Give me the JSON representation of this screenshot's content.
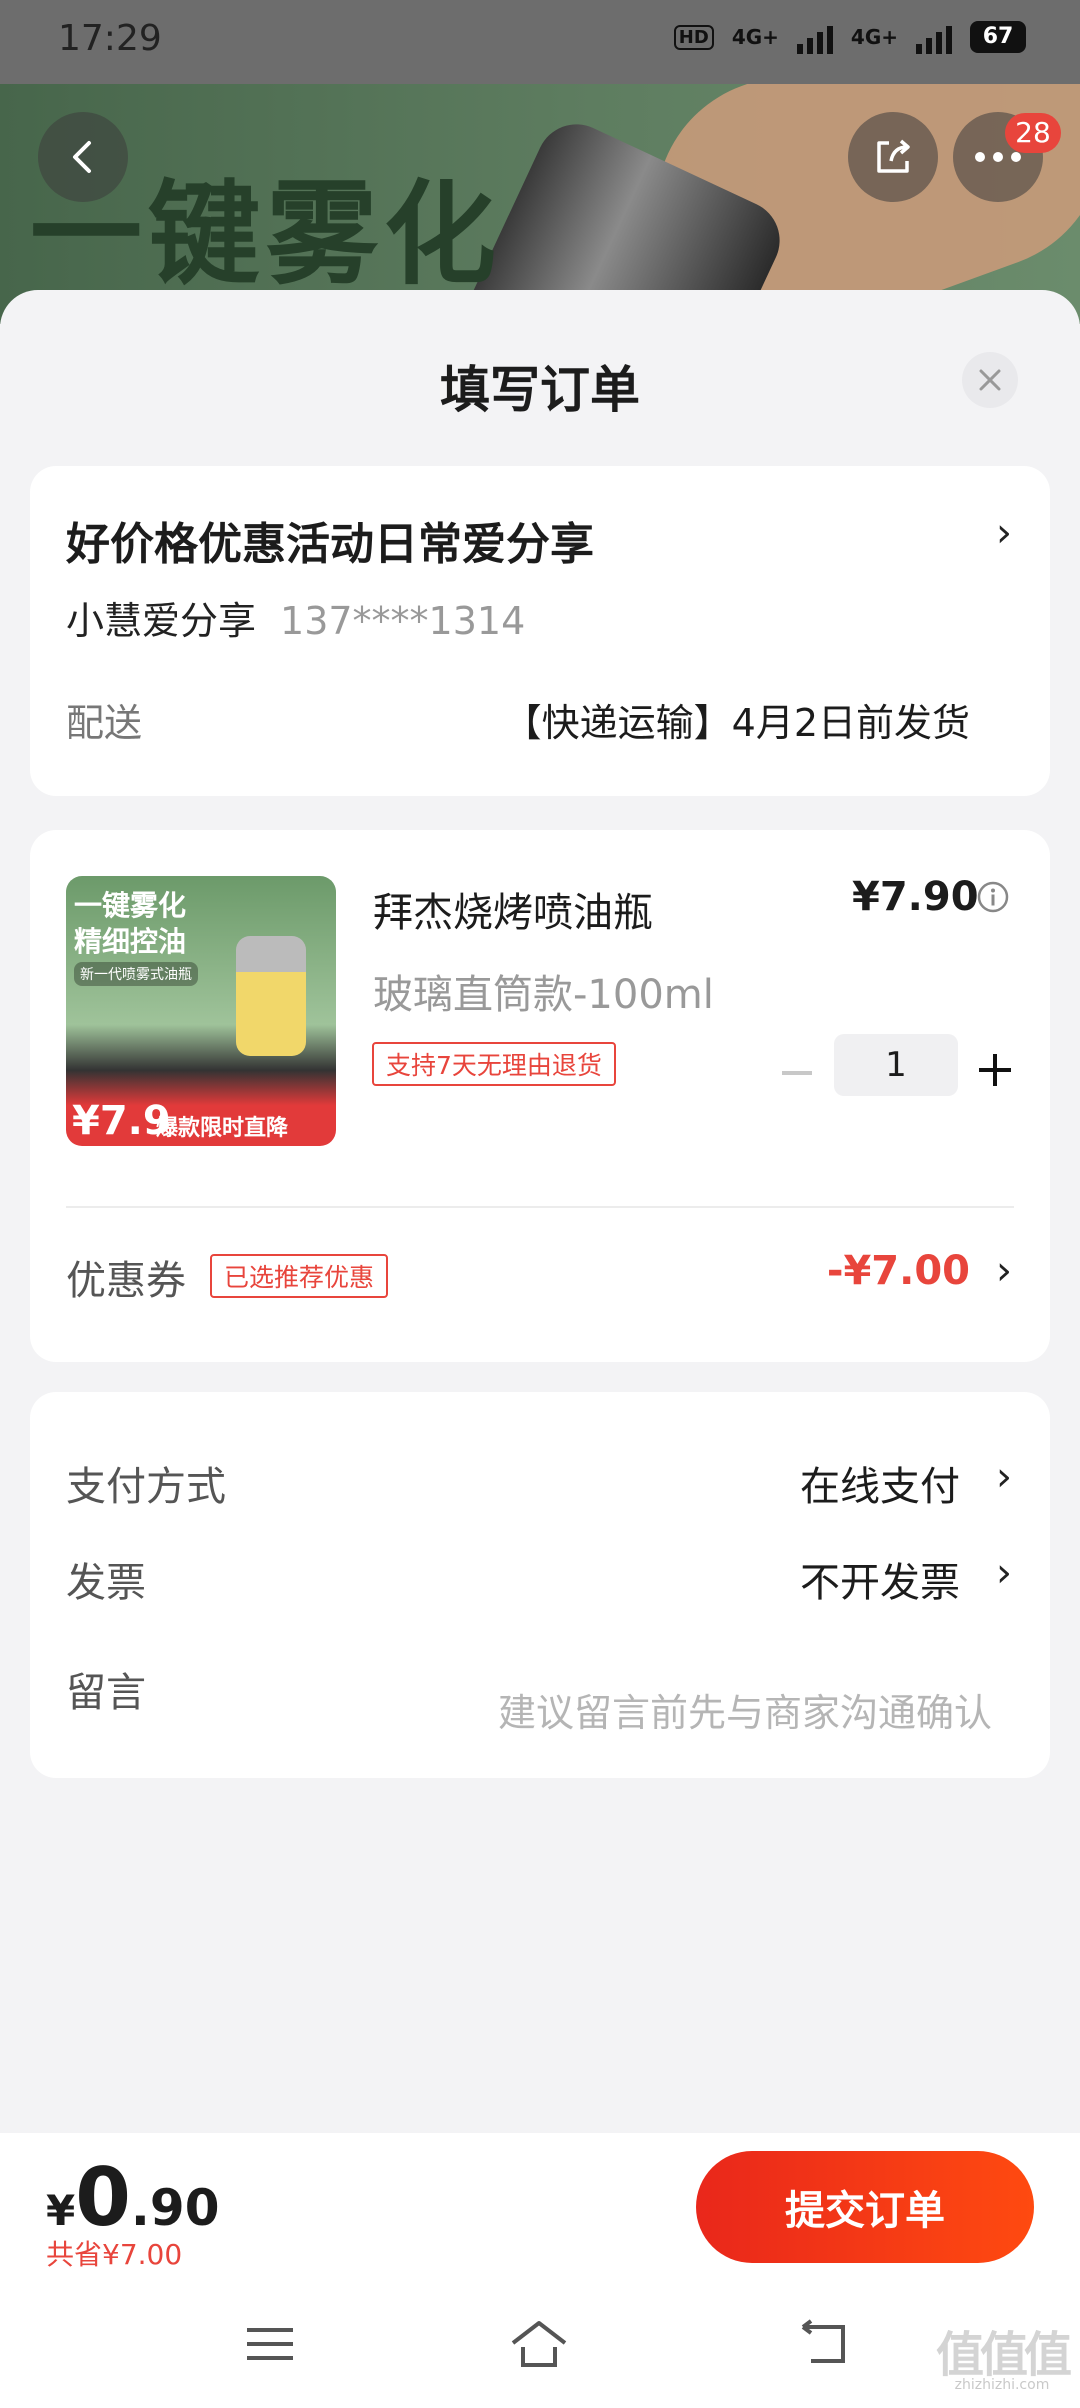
{
  "status_bar": {
    "time": "17:29",
    "network1": "4G+",
    "network2": "4G+",
    "battery": "67"
  },
  "hero": {
    "banner_text": "一键雾化",
    "badge_count": "28"
  },
  "sheet": {
    "title": "填写订单"
  },
  "address": {
    "name": "好价格优惠活动日常爱分享",
    "contact_name": "小慧爱分享",
    "phone": "137****1314",
    "delivery_label": "配送",
    "delivery_value": "【快递运输】4月2日前发货"
  },
  "item": {
    "title": "拜杰烧烤喷油瓶",
    "price": "¥7.90",
    "variant": "玻璃直筒款-100ml",
    "return_tag": "支持7天无理由退货",
    "quantity": "1",
    "thumb_text": "一键雾化\n精细控油",
    "thumb_subtext": "新一代喷雾式油瓶",
    "thumb_price": "¥7.9",
    "thumb_label": "爆款限时直降"
  },
  "coupon": {
    "label": "优惠券",
    "tag": "已选推荐优惠",
    "value": "-¥7.00"
  },
  "payment": {
    "method_label": "支付方式",
    "method_value": "在线支付",
    "invoice_label": "发票",
    "invoice_value": "不开发票",
    "remark_label": "留言",
    "remark_placeholder": "建议留言前先与商家沟通确认"
  },
  "summary": {
    "currency": "¥",
    "total_int": "0",
    "total_dec": ".90",
    "saved": "共省¥7.00",
    "submit_label": "提交订单"
  },
  "watermark": {
    "logo": "值值值",
    "site": "zhizhizhi.com"
  },
  "colors": {
    "accent": "#e8453c",
    "submit_gradient_start": "#e9271b",
    "submit_gradient_end": "#ff4a10"
  }
}
